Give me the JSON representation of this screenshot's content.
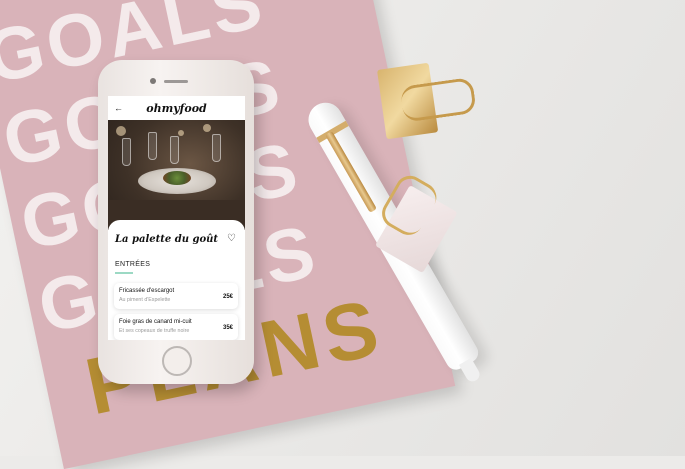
{
  "background": {
    "notebook_text": [
      "GOALS",
      "GOALS",
      "GOALS",
      "GOALS"
    ],
    "notebook_bottom_text": "PLANS",
    "colors": {
      "notebook": "#d9b3b9",
      "gold": "#b58d33"
    }
  },
  "app": {
    "brand": "ohmyfood",
    "back_icon": "arrow-left-icon",
    "restaurant": {
      "name": "La palette du goût",
      "favorite_icon": "heart-outline-icon"
    },
    "section": {
      "title": "ENTRÉES",
      "accent": "#9cd9c4"
    },
    "menu_items": [
      {
        "name": "Fricassée d'escargot",
        "description": "Au piment d'Espelette",
        "price": "25€"
      },
      {
        "name": "Foie gras de canard mi-cuit",
        "description": "Et ses copeaux de truffe noire",
        "price": "35€"
      }
    ]
  }
}
